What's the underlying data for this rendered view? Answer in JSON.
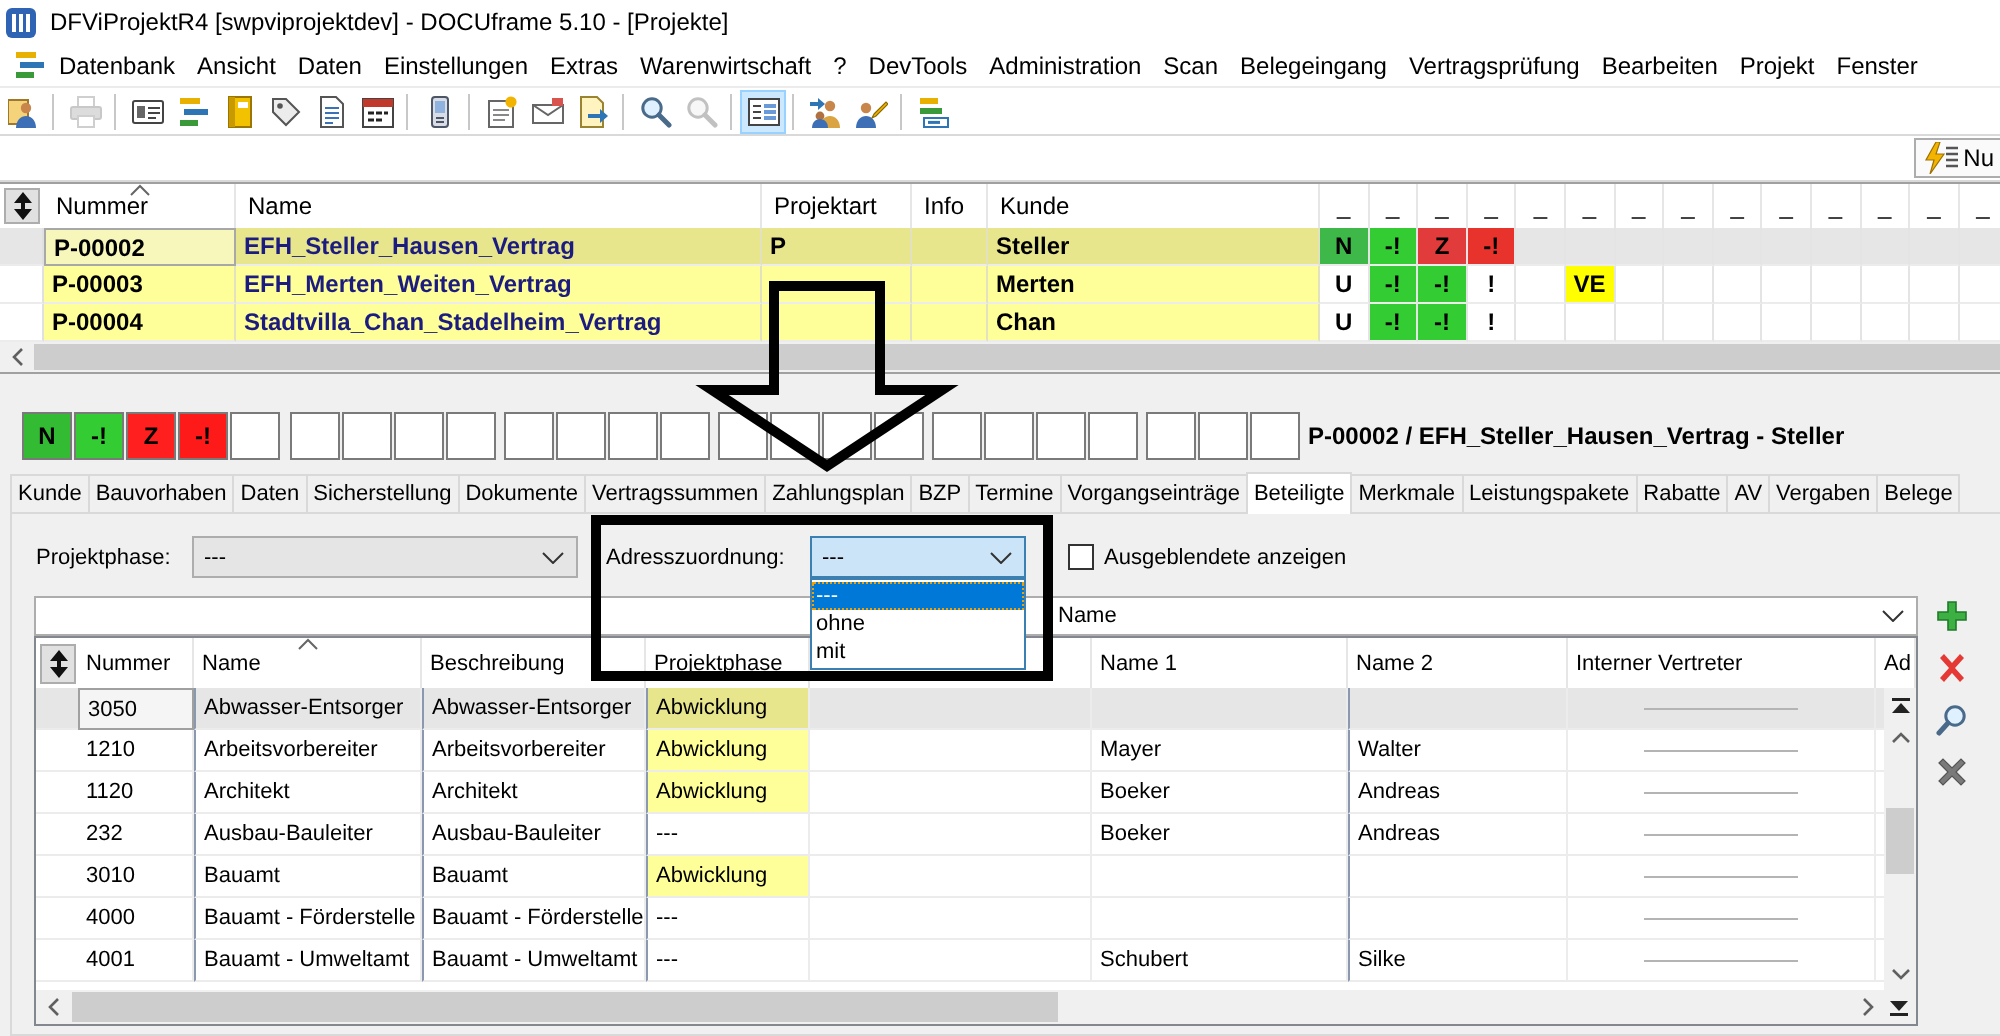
{
  "window": {
    "title": "DFViProjektR4 [swpviprojektdev] - DOCUframe 5.10 - [Projekte]"
  },
  "menu": [
    "Datenbank",
    "Ansicht",
    "Daten",
    "Einstellungen",
    "Extras",
    "Warenwirtschaft",
    "?",
    "DevTools",
    "Administration",
    "Scan",
    "Belegeingang",
    "Vertragsprüfung",
    "Bearbeiten",
    "Projekt",
    "Fenster"
  ],
  "toolbar": [
    [
      {
        "kind": "people",
        "disabled": false,
        "pressed": false
      }
    ],
    [
      {
        "kind": "printer",
        "disabled": true,
        "pressed": false
      }
    ],
    [
      {
        "kind": "id-card",
        "disabled": false,
        "pressed": false
      },
      {
        "kind": "list",
        "disabled": false,
        "pressed": false
      },
      {
        "kind": "book",
        "disabled": false,
        "pressed": false
      },
      {
        "kind": "tag",
        "disabled": false,
        "pressed": false
      },
      {
        "kind": "document",
        "disabled": false,
        "pressed": false
      },
      {
        "kind": "calendar",
        "disabled": false,
        "pressed": false
      }
    ],
    [
      {
        "kind": "phone",
        "disabled": false,
        "pressed": false
      }
    ],
    [
      {
        "kind": "note",
        "disabled": false,
        "pressed": false
      },
      {
        "kind": "envelope",
        "disabled": false,
        "pressed": false
      },
      {
        "kind": "note-arrow",
        "disabled": false,
        "pressed": false
      }
    ],
    [
      {
        "kind": "search",
        "disabled": false,
        "pressed": false
      },
      {
        "kind": "search",
        "disabled": true,
        "pressed": false
      }
    ],
    [
      {
        "kind": "form",
        "disabled": false,
        "pressed": true
      }
    ],
    [
      {
        "kind": "people-arrow",
        "disabled": false,
        "pressed": false
      },
      {
        "kind": "people-pencil",
        "disabled": false,
        "pressed": false
      }
    ],
    [
      {
        "kind": "list-arrow",
        "disabled": false,
        "pressed": false
      }
    ]
  ],
  "quick_button": {
    "label": "Nu"
  },
  "project_table": {
    "columns": [
      {
        "label": "Nummer",
        "sorted": true
      },
      {
        "label": "Name",
        "sorted": false
      },
      {
        "label": "Projektart",
        "sorted": false
      },
      {
        "label": "Info",
        "sorted": false
      },
      {
        "label": "Kunde",
        "sorted": false
      }
    ],
    "status_columns": [
      "_",
      "_",
      "_",
      "_",
      "_",
      "_",
      "_",
      "_",
      "_",
      "_",
      "_",
      "_",
      "_",
      "_"
    ],
    "rows": [
      {
        "selected": true,
        "nummer": "P-00002",
        "name": "EFH_Steller_Hausen_Vertrag",
        "projektart": "P",
        "kunde": "Steller",
        "status": [
          {
            "kind": "flag",
            "text": "N",
            "color": "#3fb84a"
          },
          {
            "kind": "flag",
            "text": "-!",
            "color": "#33cc33"
          },
          {
            "kind": "flag",
            "text": "Z",
            "color": "#e23b3b"
          },
          {
            "kind": "flag",
            "text": "-!",
            "color": "#e8322c"
          }
        ]
      },
      {
        "selected": false,
        "nummer": "P-00003",
        "name": "EFH_Merten_Weiten_Vertrag",
        "kunde": "Merten",
        "status": [
          {
            "kind": "flag",
            "text": "U"
          },
          {
            "kind": "flag",
            "text": "-!",
            "color": "#33cc33"
          },
          {
            "kind": "flag",
            "text": "-!",
            "color": "#33cc33"
          },
          {
            "kind": "flag",
            "text": "!"
          },
          {
            "kind": "blank"
          },
          {
            "kind": "flag",
            "text": "VE",
            "color": "#ffff00"
          }
        ]
      },
      {
        "selected": false,
        "nummer": "P-00004",
        "name": "Stadtvilla_Chan_Stadelheim_Vertrag",
        "kunde": "Chan",
        "status": [
          {
            "kind": "flag",
            "text": "U"
          },
          {
            "kind": "flag",
            "text": "-!",
            "color": "#33cc33"
          },
          {
            "kind": "flag",
            "text": "-!",
            "color": "#33cc33"
          },
          {
            "kind": "flag",
            "text": "!"
          }
        ]
      }
    ]
  },
  "detail": {
    "status": [
      {
        "text": "N",
        "color": "#33bb33"
      },
      {
        "text": "-!",
        "color": "#33cc33"
      },
      {
        "text": "Z",
        "color": "#ff1f1f"
      },
      {
        "text": "-!",
        "color": "#ff1a1a"
      }
    ],
    "heading": "P-00002 / EFH_Steller_Hausen_Vertrag - Steller",
    "tabs": [
      {
        "label": "Kunde",
        "selected": false
      },
      {
        "label": "Bauvorhaben",
        "selected": false
      },
      {
        "label": "Daten",
        "selected": false
      },
      {
        "label": "Sicherstellung",
        "selected": false
      },
      {
        "label": "Dokumente",
        "selected": false
      },
      {
        "label": "Vertragssummen",
        "selected": false
      },
      {
        "label": "Zahlungsplan",
        "selected": false
      },
      {
        "label": "BZP",
        "selected": false
      },
      {
        "label": "Termine",
        "selected": false
      },
      {
        "label": "Vorgangseinträge",
        "selected": false
      },
      {
        "label": "Beteiligte",
        "selected": true
      },
      {
        "label": "Merkmale",
        "selected": false
      },
      {
        "label": "Leistungspakete",
        "selected": false
      },
      {
        "label": "Rabatte",
        "selected": false
      },
      {
        "label": "AV",
        "selected": false
      },
      {
        "label": "Vergaben",
        "selected": false
      },
      {
        "label": "Belege",
        "selected": false
      }
    ]
  },
  "filters": {
    "projektphase": {
      "label": "Projektphase:",
      "value": "---"
    },
    "adresszuordnung": {
      "label": "Adresszuordnung:",
      "value": "---",
      "expanded": true,
      "options": [
        {
          "label": "---",
          "selected": true
        },
        {
          "label": "ohne",
          "selected": false
        },
        {
          "label": "mit",
          "selected": false
        }
      ]
    },
    "show_hidden": {
      "label": "Ausgeblendete anzeigen",
      "checked": false
    }
  },
  "group_field": {
    "value": "Name"
  },
  "side_actions": [
    {
      "kind": "add"
    },
    {
      "kind": "delete"
    },
    {
      "kind": "search"
    },
    {
      "kind": "cancel"
    }
  ],
  "participants_table": {
    "columns": [
      {
        "kind": "label",
        "label": "Nummer",
        "sorted": false
      },
      {
        "kind": "label",
        "label": "Name",
        "sorted": true
      },
      {
        "kind": "label",
        "label": "Beschreibung",
        "sorted": false
      },
      {
        "kind": "label",
        "label": "Projektphase",
        "sorted": false
      },
      {
        "kind": "blank"
      },
      {
        "kind": "label",
        "label": "Name 1",
        "sorted": false
      },
      {
        "kind": "label",
        "label": "Name 2",
        "sorted": false
      },
      {
        "kind": "label",
        "label": "Interner Vertreter",
        "sorted": false
      },
      {
        "kind": "label",
        "label": "Ad",
        "sorted": false
      }
    ],
    "rows": [
      {
        "selected": true,
        "nummer": "3050",
        "name": "Abwasser-Entsorger",
        "beschreibung": "Abwasser-Entsorger",
        "projektphase": "Abwicklung",
        "phase_highlighted": true
      },
      {
        "selected": false,
        "nummer": "1210",
        "name": "Arbeitsvorbereiter",
        "beschreibung": "Arbeitsvorbereiter",
        "projektphase": "Abwicklung",
        "phase_highlighted": true,
        "name_1": "Mayer",
        "name_2": "Walter"
      },
      {
        "selected": false,
        "nummer": "1120",
        "name": "Architekt",
        "beschreibung": "Architekt",
        "projektphase": "Abwicklung",
        "phase_highlighted": true,
        "name_1": "Boeker",
        "name_2": "Andreas"
      },
      {
        "selected": false,
        "nummer": "232",
        "name": "Ausbau-Bauleiter",
        "beschreibung": "Ausbau-Bauleiter",
        "projektphase": "---",
        "phase_highlighted": false,
        "name_1": "Boeker",
        "name_2": "Andreas"
      },
      {
        "selected": false,
        "nummer": "3010",
        "name": "Bauamt",
        "beschreibung": "Bauamt",
        "projektphase": "Abwicklung",
        "phase_highlighted": true
      },
      {
        "selected": false,
        "nummer": "4000",
        "name": "Bauamt - Förderstelle",
        "beschreibung": "Bauamt - Förderstelle",
        "projektphase": "---",
        "phase_highlighted": false
      },
      {
        "selected": false,
        "nummer": "4001",
        "name": "Bauamt - Umweltamt",
        "beschreibung": "Bauamt - Umweltamt",
        "projektphase": "---",
        "phase_highlighted": false,
        "name_1": "Schubert",
        "name_2": "Silke"
      }
    ]
  },
  "annotations": {
    "arrow": true,
    "frame": true
  }
}
